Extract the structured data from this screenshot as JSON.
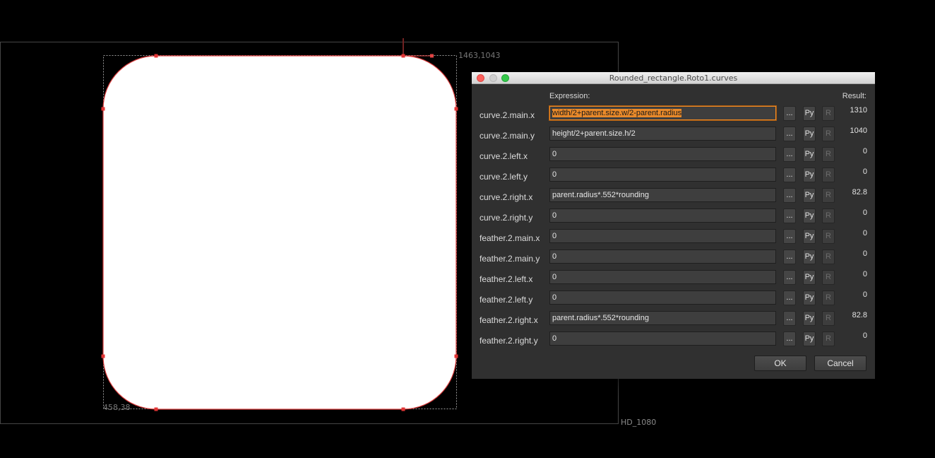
{
  "viewer": {
    "top_right_coord": "1463,1043",
    "bottom_left_coord": "458,38",
    "format_label": "HD_1080"
  },
  "dialog": {
    "title": "Rounded_rectangle.Roto1.curves",
    "header_expression": "Expression:",
    "header_result": "Result:",
    "btn_dots": "...",
    "btn_py": "Py",
    "btn_r": "R",
    "ok_label": "OK",
    "cancel_label": "Cancel",
    "rows": [
      {
        "label": "curve.2.main.x",
        "expression": "width/2+parent.size.w/2-parent.radius",
        "result": "1310"
      },
      {
        "label": "curve.2.main.y",
        "expression": "height/2+parent.size.h/2",
        "result": "1040"
      },
      {
        "label": "curve.2.left.x",
        "expression": "0",
        "result": "0"
      },
      {
        "label": "curve.2.left.y",
        "expression": "0",
        "result": "0"
      },
      {
        "label": "curve.2.right.x",
        "expression": "parent.radius*.552*rounding",
        "result": "82.8"
      },
      {
        "label": "curve.2.right.y",
        "expression": "0",
        "result": "0"
      },
      {
        "label": "feather.2.main.x",
        "expression": "0",
        "result": "0"
      },
      {
        "label": "feather.2.main.y",
        "expression": "0",
        "result": "0"
      },
      {
        "label": "feather.2.left.x",
        "expression": "0",
        "result": "0"
      },
      {
        "label": "feather.2.left.y",
        "expression": "0",
        "result": "0"
      },
      {
        "label": "feather.2.right.x",
        "expression": "parent.radius*.552*rounding",
        "result": "82.8"
      },
      {
        "label": "feather.2.right.y",
        "expression": "0",
        "result": "0"
      }
    ]
  }
}
